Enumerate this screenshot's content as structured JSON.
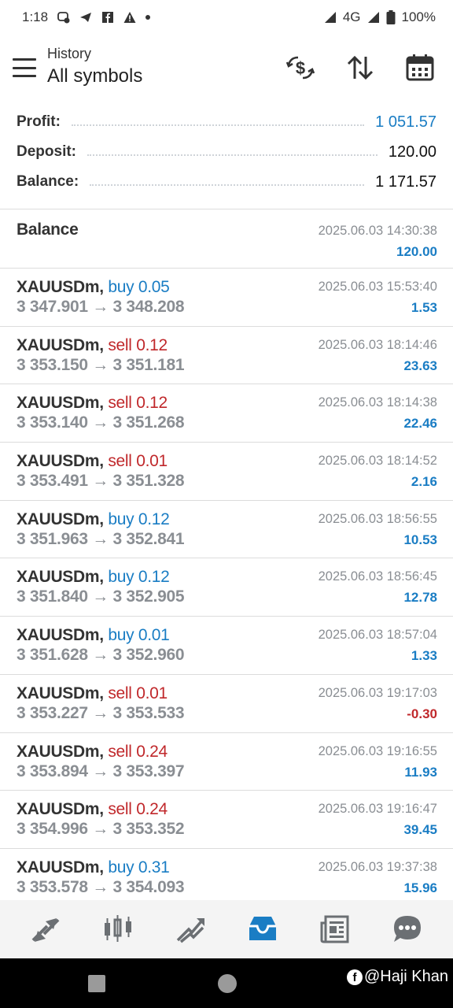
{
  "status_bar": {
    "time": "1:18",
    "network": "4G",
    "battery": "100%"
  },
  "header": {
    "subtitle": "History",
    "title": "All symbols",
    "icons": [
      "currency-exchange-icon",
      "sort-icon",
      "calendar-icon"
    ]
  },
  "summary": {
    "profit_label": "Profit:",
    "profit_value": "1 051.57",
    "deposit_label": "Deposit:",
    "deposit_value": "120.00",
    "balance_label": "Balance:",
    "balance_value": "1 171.57"
  },
  "balance_entry": {
    "label": "Balance",
    "time": "2025.06.03 14:30:38",
    "amount": "120.00"
  },
  "deals": [
    {
      "symbol": "XAUUSDm,",
      "type": "buy 0.05",
      "side": "buy",
      "prices": "3 347.901 → 3 348.208",
      "time": "2025.06.03 15:53:40",
      "profit": "1.53"
    },
    {
      "symbol": "XAUUSDm,",
      "type": "sell 0.12",
      "side": "sell",
      "prices": "3 353.150 → 3 351.181",
      "time": "2025.06.03 18:14:46",
      "profit": "23.63"
    },
    {
      "symbol": "XAUUSDm,",
      "type": "sell 0.12",
      "side": "sell",
      "prices": "3 353.140 → 3 351.268",
      "time": "2025.06.03 18:14:38",
      "profit": "22.46"
    },
    {
      "symbol": "XAUUSDm,",
      "type": "sell 0.01",
      "side": "sell",
      "prices": "3 353.491 → 3 351.328",
      "time": "2025.06.03 18:14:52",
      "profit": "2.16"
    },
    {
      "symbol": "XAUUSDm,",
      "type": "buy 0.12",
      "side": "buy",
      "prices": "3 351.963 → 3 352.841",
      "time": "2025.06.03 18:56:55",
      "profit": "10.53"
    },
    {
      "symbol": "XAUUSDm,",
      "type": "buy 0.12",
      "side": "buy",
      "prices": "3 351.840 → 3 352.905",
      "time": "2025.06.03 18:56:45",
      "profit": "12.78"
    },
    {
      "symbol": "XAUUSDm,",
      "type": "buy 0.01",
      "side": "buy",
      "prices": "3 351.628 → 3 352.960",
      "time": "2025.06.03 18:57:04",
      "profit": "1.33"
    },
    {
      "symbol": "XAUUSDm,",
      "type": "sell 0.01",
      "side": "sell",
      "prices": "3 353.227 → 3 353.533",
      "time": "2025.06.03 19:17:03",
      "profit": "-0.30"
    },
    {
      "symbol": "XAUUSDm,",
      "type": "sell 0.24",
      "side": "sell",
      "prices": "3 353.894 → 3 353.397",
      "time": "2025.06.03 19:16:55",
      "profit": "11.93"
    },
    {
      "symbol": "XAUUSDm,",
      "type": "sell 0.24",
      "side": "sell",
      "prices": "3 354.996 → 3 353.352",
      "time": "2025.06.03 19:16:47",
      "profit": "39.45"
    },
    {
      "symbol": "XAUUSDm,",
      "type": "buy 0.31",
      "side": "buy",
      "prices": "3 353.578 → 3 354.093",
      "time": "2025.06.03 19:37:38",
      "profit": "15.96"
    }
  ],
  "bottom_nav": [
    "trade-quotes-icon",
    "chart-icon",
    "trade-icon",
    "history-icon",
    "news-icon",
    "chat-icon"
  ],
  "colors": {
    "accent_blue": "#1a7dc4",
    "sell_red": "#c0282b",
    "muted_gray": "#8a8e93"
  },
  "watermark": "@Haji Khan"
}
